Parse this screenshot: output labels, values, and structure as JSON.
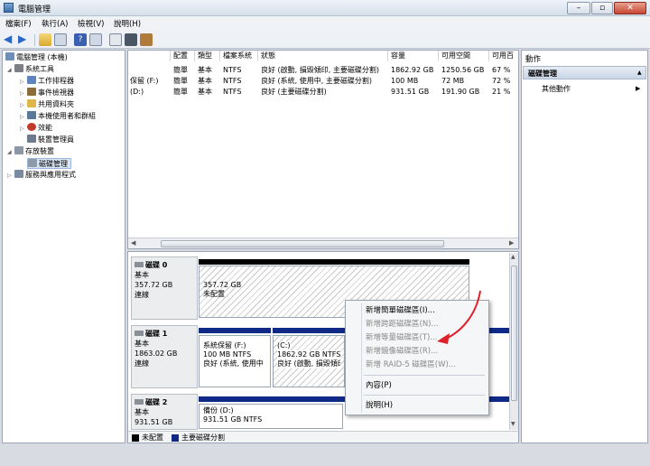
{
  "window": {
    "title": "電腦管理"
  },
  "menubar": [
    "檔案(F)",
    "執行(A)",
    "檢視(V)",
    "說明(H)"
  ],
  "tree": {
    "root": "電腦管理 (本機)",
    "items": [
      {
        "label": "系統工具",
        "level": 1,
        "expanded": true
      },
      {
        "label": "工作排程器",
        "level": 2
      },
      {
        "label": "事件檢視器",
        "level": 2
      },
      {
        "label": "共用資料夾",
        "level": 2
      },
      {
        "label": "本機使用者和群組",
        "level": 2
      },
      {
        "label": "效能",
        "level": 2
      },
      {
        "label": "裝置管理員",
        "level": 2
      },
      {
        "label": "存放裝置",
        "level": 1,
        "expanded": true
      },
      {
        "label": "磁碟管理",
        "level": 2,
        "selected": true
      },
      {
        "label": "服務與應用程式",
        "level": 1
      }
    ]
  },
  "volume_table": {
    "columns": [
      "配置",
      "類型",
      "檔案系統",
      "狀態",
      "容量",
      "可用空間",
      "可用百"
    ],
    "rows": [
      {
        "volume": "",
        "layout": "簡單",
        "type": "基本",
        "fs": "NTFS",
        "status": "良好 (啟動, 損毀傾印, 主要磁碟分割)",
        "capacity": "1862.92 GB",
        "free": "1250.56 GB",
        "pct": "67 %"
      },
      {
        "volume": "保留 (F:)",
        "layout": "簡單",
        "type": "基本",
        "fs": "NTFS",
        "status": "良好 (系統, 使用中, 主要磁碟分割)",
        "capacity": "100 MB",
        "free": "72 MB",
        "pct": "72 %"
      },
      {
        "volume": "(D:)",
        "layout": "簡單",
        "type": "基本",
        "fs": "NTFS",
        "status": "良好 (主要磁碟分割)",
        "capacity": "931.51 GB",
        "free": "191.90 GB",
        "pct": "21 %"
      }
    ]
  },
  "disks": [
    {
      "name": "磁碟 0",
      "type": "基本",
      "size": "357.72 GB",
      "status": "連線",
      "partitions": [
        {
          "size": "357.72 GB",
          "label": "未配置"
        }
      ]
    },
    {
      "name": "磁碟 1",
      "type": "基本",
      "size": "1863.02 GB",
      "status": "連線",
      "partitions": [
        {
          "name": "系統保留 (F:)",
          "size": "100 MB NTFS",
          "status": "良好 (系統, 使用中"
        },
        {
          "name": "(C:)",
          "size": "1862.92 GB NTFS",
          "status": "良好 (啟動, 損毀傾印"
        }
      ]
    },
    {
      "name": "磁碟 2",
      "type": "基本",
      "size": "931.51 GB",
      "status": "連線",
      "partitions": [
        {
          "name": "備份 (D:)",
          "size": "931.51 GB NTFS",
          "status": ""
        }
      ]
    }
  ],
  "legend": {
    "unallocated": "未配置",
    "primary": "主要磁碟分割"
  },
  "actions": {
    "header": "動作",
    "section": "磁碟管理",
    "more": "其他動作"
  },
  "context_menu": [
    {
      "label": "新增簡單磁碟區(I)...",
      "enabled": true
    },
    {
      "label": "新增跨距磁碟區(N)...",
      "enabled": false
    },
    {
      "label": "新增等量磁碟區(T)...",
      "enabled": false
    },
    {
      "label": "新增鏡像磁碟區(R)...",
      "enabled": false
    },
    {
      "label": "新增 RAID-5 磁碟區(W)...",
      "enabled": false
    },
    {
      "label": "內容(P)",
      "enabled": true
    },
    {
      "label": "說明(H)",
      "enabled": true
    }
  ],
  "colors": {
    "primary_partition": "#0e2a86",
    "disk_bar": "#000000",
    "annotation": "#e0202a"
  }
}
